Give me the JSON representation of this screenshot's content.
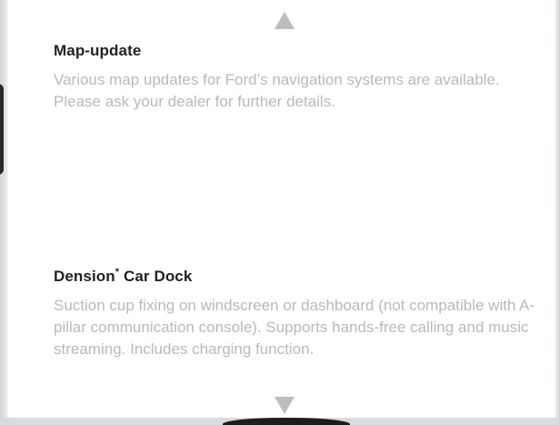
{
  "sections": [
    {
      "title": "Map-update",
      "body": "Various map updates for Ford’s navigation systems are available. Please ask your dealer for further details."
    },
    {
      "title": "Dension",
      "title_mark": "*",
      "title_suffix": " Car Dock",
      "body": "Suction cup fixing on windscreen or dashboard (not compatible with A-pillar communication console). Supports hands-free calling and music streaming. Includes charging function."
    }
  ],
  "icons": {
    "scroll_up": "triangle-up-icon",
    "scroll_down": "triangle-down-icon"
  },
  "colors": {
    "title": "#222222",
    "body": "#b9b9b9",
    "arrow": "#bdbdbd"
  }
}
